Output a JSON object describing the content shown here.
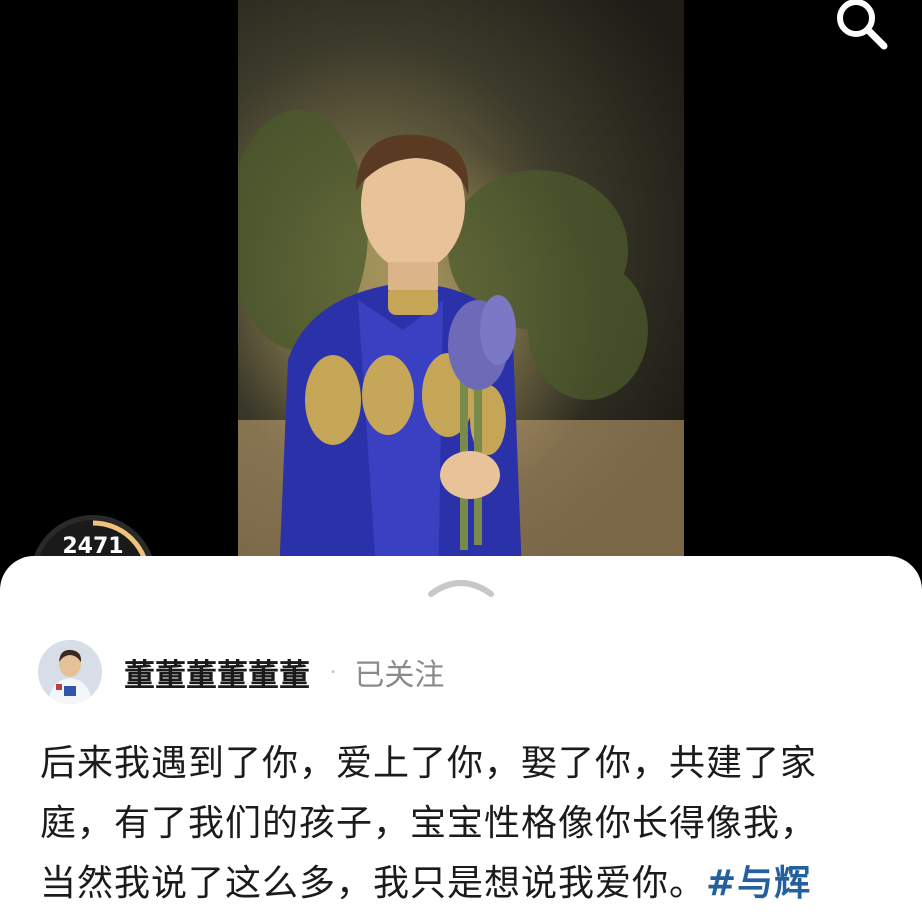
{
  "video": {
    "views": "2471"
  },
  "post": {
    "author_name": "董董董董董董",
    "separator": "·",
    "follow_status": "已关注",
    "caption_lines": [
      "后来我遇到了你，爱上了你，娶了你，共建了家",
      "庭，有了我们的孩子，宝宝性格像你长得像我，",
      "当然我说了这么多，我只是想说我爱你。"
    ],
    "hashtag": "#与辉"
  },
  "icons": {
    "search": "search-icon",
    "collapse_handle": "chevron-up-icon",
    "avatar": "avatar"
  },
  "colors": {
    "hashtag": "#245f9e",
    "progress_ring": "#f0c27b",
    "background": "#000000"
  }
}
